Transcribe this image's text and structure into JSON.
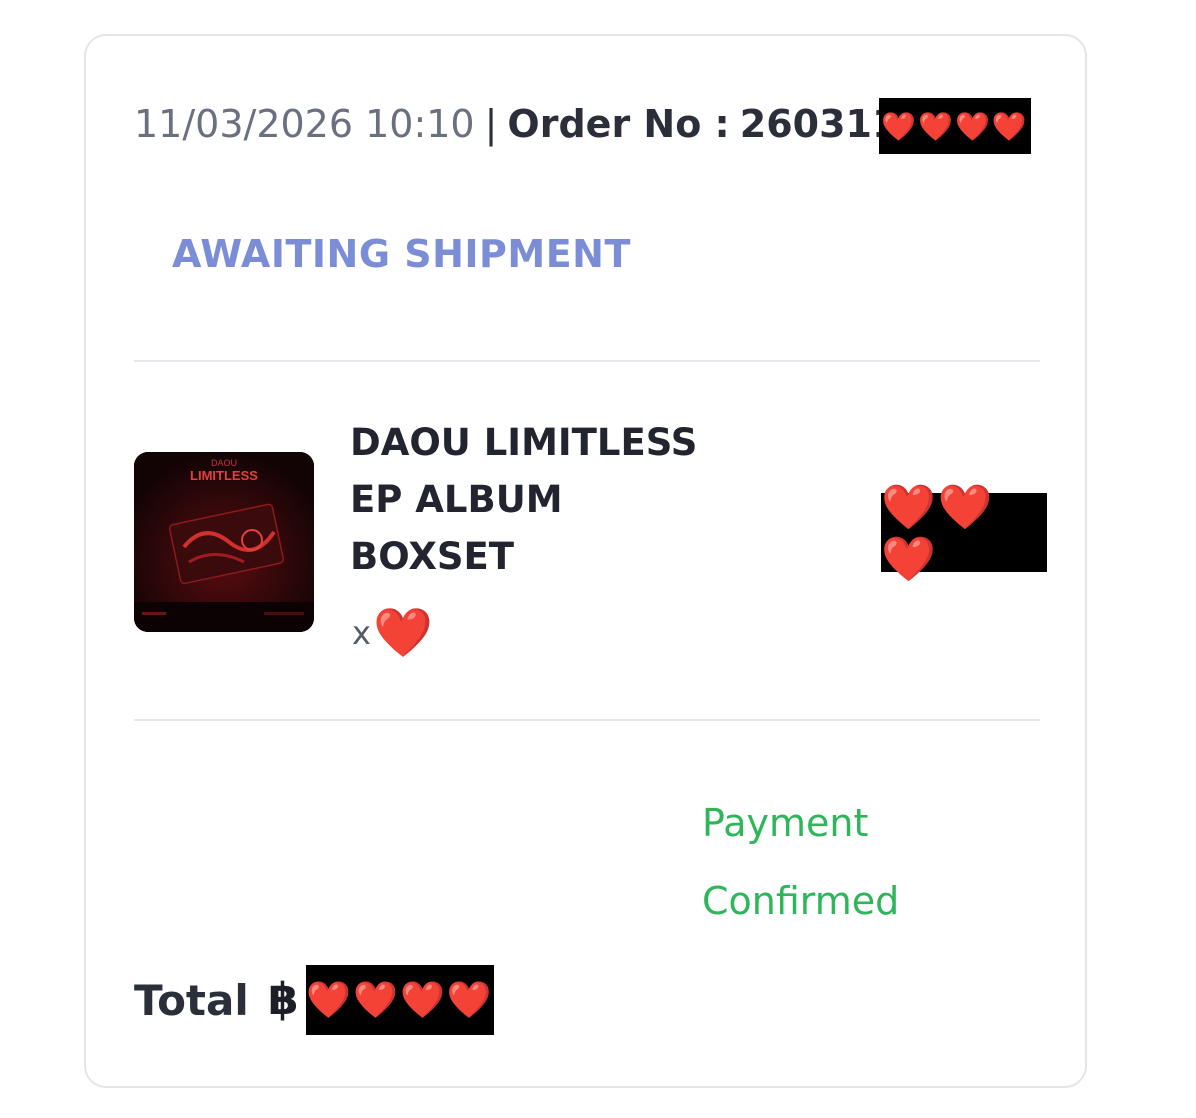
{
  "order": {
    "date_time": "11/03/2026 10:10",
    "separator": "|",
    "order_label": "Order No :",
    "order_number_visible": "260311",
    "order_number_redacted": "❤️❤️❤️❤️"
  },
  "status": {
    "label": "AWAITING SHIPMENT",
    "color": "#7b8dd6"
  },
  "item": {
    "name_lines": [
      "DAOU LIMITLESS",
      "EP ALBUM",
      "BOXSET"
    ],
    "quantity_prefix": "x",
    "quantity_redacted": "❤️",
    "price_redacted": "❤️❤️❤️",
    "thumbnail": {
      "text_title": "DAOU",
      "text_subtitle": "LIMITLESS"
    }
  },
  "payment": {
    "status_lines": [
      "Payment",
      "Confirmed"
    ],
    "color": "#2fb65a"
  },
  "total": {
    "label": "Total",
    "currency_symbol": "฿",
    "amount_redacted": "❤️❤️❤️❤️"
  },
  "colors": {
    "redaction_bg": "#000000",
    "heart": "#e01b24",
    "card_border": "#e4e5ea"
  }
}
